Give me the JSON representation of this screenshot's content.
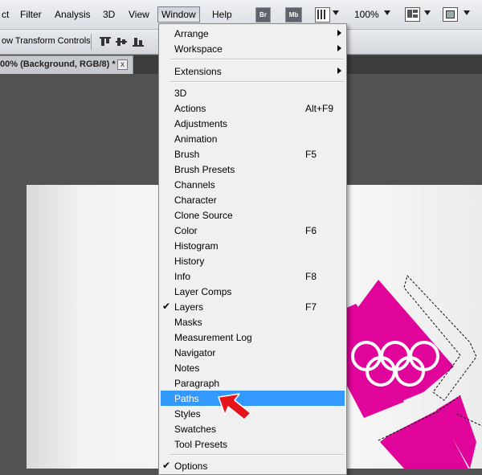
{
  "menubar": {
    "items": [
      {
        "label": "ct",
        "name": "menu-select"
      },
      {
        "label": "Filter",
        "name": "menu-filter"
      },
      {
        "label": "Analysis",
        "name": "menu-analysis"
      },
      {
        "label": "3D",
        "name": "menu-3d"
      },
      {
        "label": "View",
        "name": "menu-view"
      },
      {
        "label": "Window",
        "name": "menu-window"
      },
      {
        "label": "Help",
        "name": "menu-help"
      }
    ],
    "br_label": "Br",
    "mb_label": "Mb",
    "zoom": "100%"
  },
  "options_bar": {
    "show_transform": "ow Transform Controls"
  },
  "document_tab": {
    "title": "00% (Background, RGB/8) *",
    "close": "x"
  },
  "window_menu": {
    "items": [
      {
        "label": "Arrange",
        "submenu": true
      },
      {
        "label": "Workspace",
        "submenu": true
      },
      {
        "label": "Extensions",
        "submenu": true
      },
      {
        "label": "3D"
      },
      {
        "label": "Actions",
        "shortcut": "Alt+F9"
      },
      {
        "label": "Adjustments"
      },
      {
        "label": "Animation"
      },
      {
        "label": "Brush",
        "shortcut": "F5"
      },
      {
        "label": "Brush Presets"
      },
      {
        "label": "Channels"
      },
      {
        "label": "Character"
      },
      {
        "label": "Clone Source"
      },
      {
        "label": "Color",
        "shortcut": "F6"
      },
      {
        "label": "Histogram"
      },
      {
        "label": "History"
      },
      {
        "label": "Info",
        "shortcut": "F8"
      },
      {
        "label": "Layer Comps"
      },
      {
        "label": "Layers",
        "shortcut": "F7",
        "checked": true
      },
      {
        "label": "Masks"
      },
      {
        "label": "Measurement Log"
      },
      {
        "label": "Navigator"
      },
      {
        "label": "Notes"
      },
      {
        "label": "Paragraph"
      },
      {
        "label": "Paths",
        "highlighted": true
      },
      {
        "label": "Styles"
      },
      {
        "label": "Swatches"
      },
      {
        "label": "Tool Presets"
      },
      {
        "label": "Options",
        "checked": true
      }
    ],
    "check_glyph": "✔"
  },
  "colors": {
    "highlight": "#3399ff",
    "logo_magenta": "#e0049a",
    "arrow_red": "#e8141b"
  }
}
